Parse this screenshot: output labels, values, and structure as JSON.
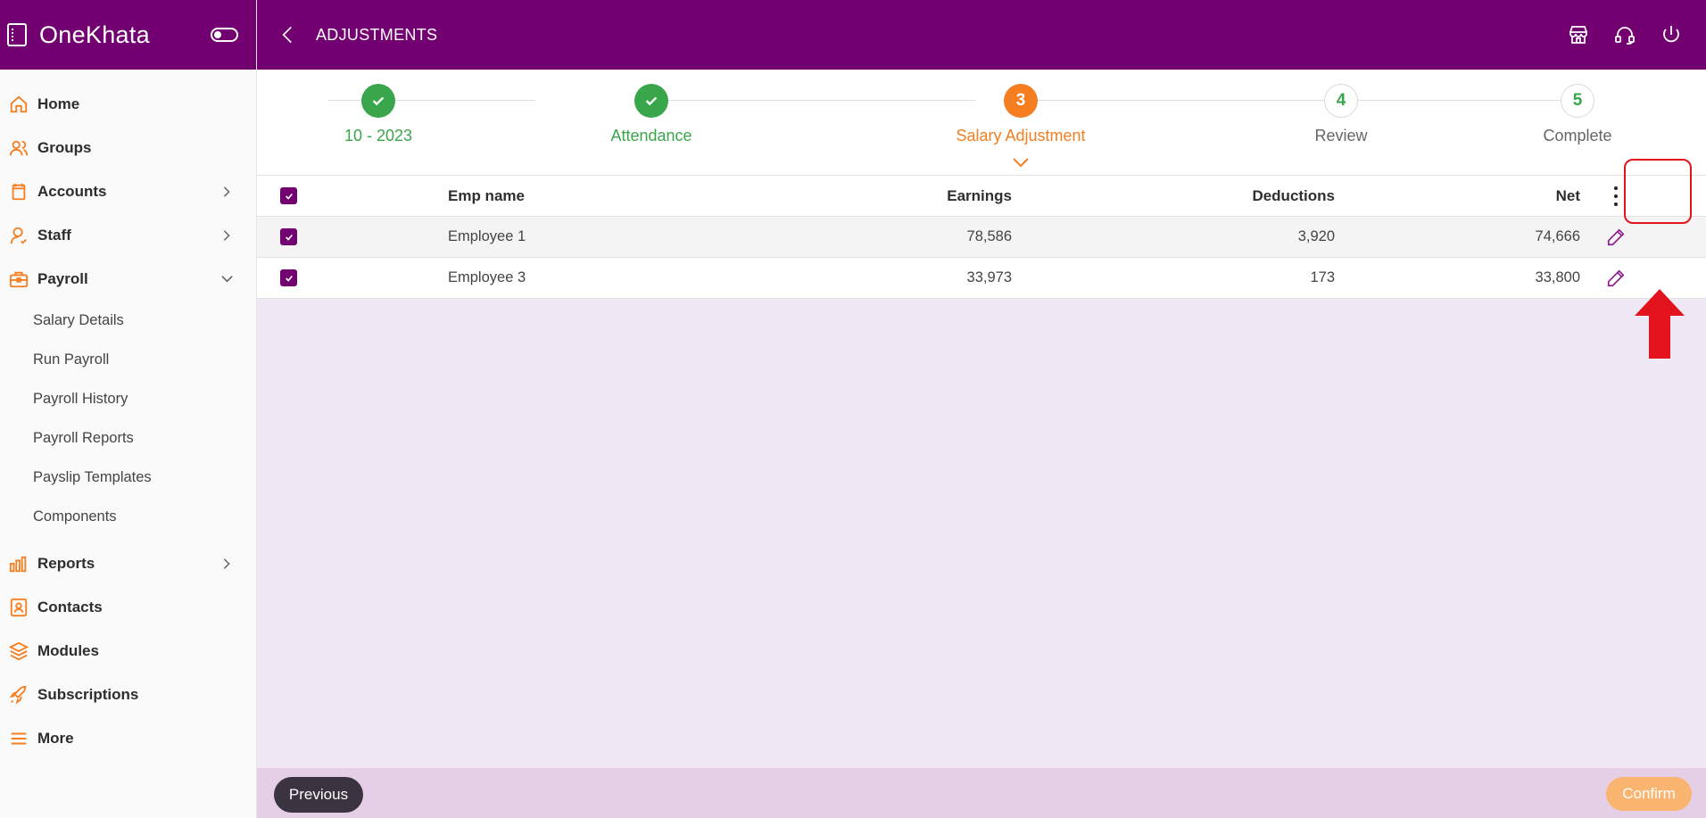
{
  "app": {
    "name": "OneKhata"
  },
  "header": {
    "title": "ADJUSTMENTS",
    "icons": [
      "back-arrow-icon",
      "store-icon",
      "headset-icon",
      "power-icon"
    ]
  },
  "sidebar": {
    "items": [
      {
        "label": "Home",
        "icon": "home-icon"
      },
      {
        "label": "Groups",
        "icon": "groups-icon"
      },
      {
        "label": "Accounts",
        "icon": "book-icon",
        "chevron": "right"
      },
      {
        "label": "Staff",
        "icon": "staff-icon",
        "chevron": "right"
      },
      {
        "label": "Payroll",
        "icon": "briefcase-icon",
        "chevron": "down"
      },
      {
        "label": "Reports",
        "icon": "bar-chart-icon",
        "chevron": "right"
      },
      {
        "label": "Contacts",
        "icon": "contact-book-icon"
      },
      {
        "label": "Modules",
        "icon": "layers-icon"
      },
      {
        "label": "Subscriptions",
        "icon": "rocket-icon"
      },
      {
        "label": "More",
        "icon": "menu-icon"
      }
    ],
    "payroll_sub": [
      "Salary Details",
      "Run Payroll",
      "Payroll History",
      "Payroll Reports",
      "Payslip Templates",
      "Components"
    ]
  },
  "stepper": {
    "steps": [
      {
        "label": "10 - 2023",
        "marker": "",
        "state": "done"
      },
      {
        "label": "Attendance",
        "marker": "",
        "state": "done"
      },
      {
        "label": "Salary Adjustment",
        "marker": "3",
        "state": "active"
      },
      {
        "label": "Review",
        "marker": "4",
        "state": "todo"
      },
      {
        "label": "Complete",
        "marker": "5",
        "state": "todo"
      }
    ]
  },
  "table": {
    "headers": {
      "name": "Emp name",
      "earnings": "Earnings",
      "deductions": "Deductions",
      "net": "Net"
    },
    "rows": [
      {
        "name": "Employee 1",
        "earnings": "78,586",
        "deductions": "3,920",
        "net": "74,666"
      },
      {
        "name": "Employee 3",
        "earnings": "33,973",
        "deductions": "173",
        "net": "33,800"
      }
    ]
  },
  "footer": {
    "previous": "Previous",
    "confirm": "Confirm"
  },
  "colors": {
    "brand_purple": "#720071",
    "accent_orange": "#f47e20",
    "success_green": "#3aa64c",
    "annotation_red": "#e3131e",
    "content_bg": "#f0e9f5",
    "footer_bg": "#e5cfe6"
  }
}
